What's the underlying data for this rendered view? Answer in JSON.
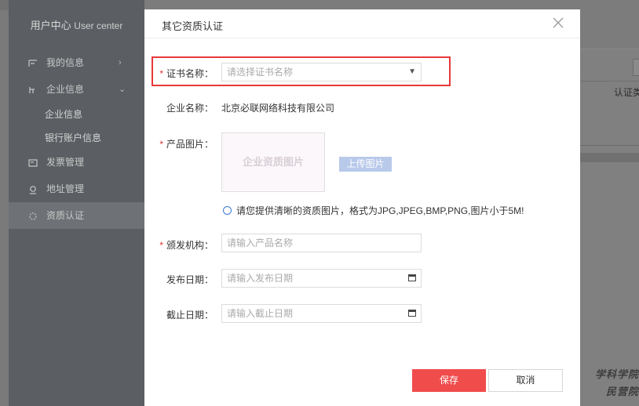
{
  "sidebar": {
    "title": "用户中心",
    "title_en": "User center",
    "items": [
      {
        "label": "我的信息",
        "icon": "id-card-icon",
        "arrow": "›"
      },
      {
        "label": "企业信息",
        "icon": "building-icon",
        "arrow": "⌄"
      },
      {
        "label": "发票管理",
        "icon": "invoice-icon"
      },
      {
        "label": "地址管理",
        "icon": "location-pin-icon"
      },
      {
        "label": "资质认证",
        "icon": "certificate-icon"
      }
    ],
    "sub_items": [
      {
        "label": "企业信息"
      },
      {
        "label": "银行账户信息"
      }
    ]
  },
  "background": {
    "column_header": "认证类"
  },
  "watermark": {
    "line1": "学科学院",
    "line2": "民营院"
  },
  "modal": {
    "title": "其它资质认证",
    "close_icon": "close-icon",
    "fields": {
      "certificate_name": {
        "label": "证书名称：",
        "placeholder": "请选择证书名称",
        "required": true
      },
      "company_name": {
        "label": "企业名称：",
        "value": "北京必联网络科技有限公司"
      },
      "product_image": {
        "label": "产品图片：",
        "placeholder": "企业资质图片",
        "upload_label": "上传图片",
        "required": true
      },
      "image_hint": "请您提供清晰的资质图片，格式为JPG,JPEG,BMP,PNG,图片小于5M!",
      "issuer": {
        "label": "颁发机构：",
        "placeholder": "请输入产品名称",
        "required": true
      },
      "issue_date": {
        "label": "发布日期：",
        "placeholder": "请输入发布日期"
      },
      "expiry_date": {
        "label": "截止日期：",
        "placeholder": "请输入截止日期"
      }
    },
    "buttons": {
      "save": "保存",
      "cancel": "取消"
    },
    "required_mark": "*"
  },
  "colors": {
    "primary_button": "#f04c4c",
    "upload_button": "#b9c9ea",
    "highlight": "#e8383a",
    "required": "#e0322d"
  }
}
